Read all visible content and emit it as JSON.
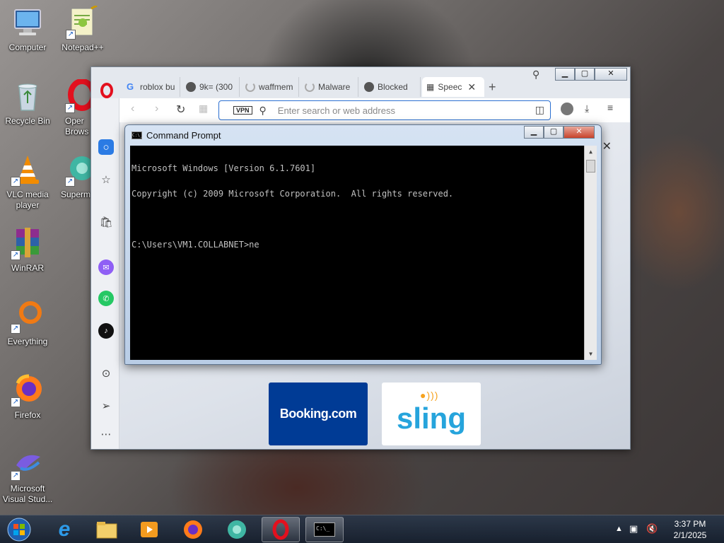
{
  "desktop": {
    "icons": [
      {
        "label": "Computer",
        "icon": "computer-icon"
      },
      {
        "label": "Notepad++",
        "icon": "notepadpp-icon"
      },
      {
        "label": "Recycle Bin",
        "icon": "recycle-bin-icon"
      },
      {
        "label": "Oper Brows",
        "icon": "opera-icon"
      },
      {
        "label": "VLC media player",
        "icon": "vlc-icon"
      },
      {
        "label": "Superm",
        "icon": "supermium-icon"
      },
      {
        "label": "WinRAR",
        "icon": "winrar-icon"
      },
      {
        "label": "Everything",
        "icon": "everything-icon"
      },
      {
        "label": "Firefox",
        "icon": "firefox-icon"
      },
      {
        "label": "Microsoft Visual Stud...",
        "icon": "visual-studio-icon"
      }
    ]
  },
  "browser": {
    "tabs": [
      {
        "label": "roblox bu",
        "icon": "google-icon"
      },
      {
        "label": "9k= (300",
        "icon": "globe-icon"
      },
      {
        "label": "waffmem",
        "icon": "loading-icon"
      },
      {
        "label": "Malware",
        "icon": "loading-icon"
      },
      {
        "label": "Blocked",
        "icon": "globe-icon"
      },
      {
        "label": "Speec",
        "icon": "speed-dial-icon"
      }
    ],
    "address_placeholder": "Enter search or web address",
    "vpn_label": "VPN",
    "tiles": [
      {
        "label": "Booking.com",
        "color": "#003b95"
      },
      {
        "label": "sling",
        "color": "#ffffff"
      }
    ]
  },
  "cmd": {
    "title": "Command Prompt",
    "icon_text": "C:\\_",
    "lines": [
      "Microsoft Windows [Version 6.1.7601]",
      "Copyright (c) 2009 Microsoft Corporation.  All rights reserved.",
      "",
      "C:\\Users\\VM1.COLLABNET>ne"
    ]
  },
  "taskbar": {
    "time": "3:37 PM",
    "date": "2/1/2025",
    "apps": [
      "start",
      "internet-explorer",
      "file-explorer",
      "media-player",
      "firefox",
      "supermium",
      "opera",
      "command-prompt"
    ]
  }
}
